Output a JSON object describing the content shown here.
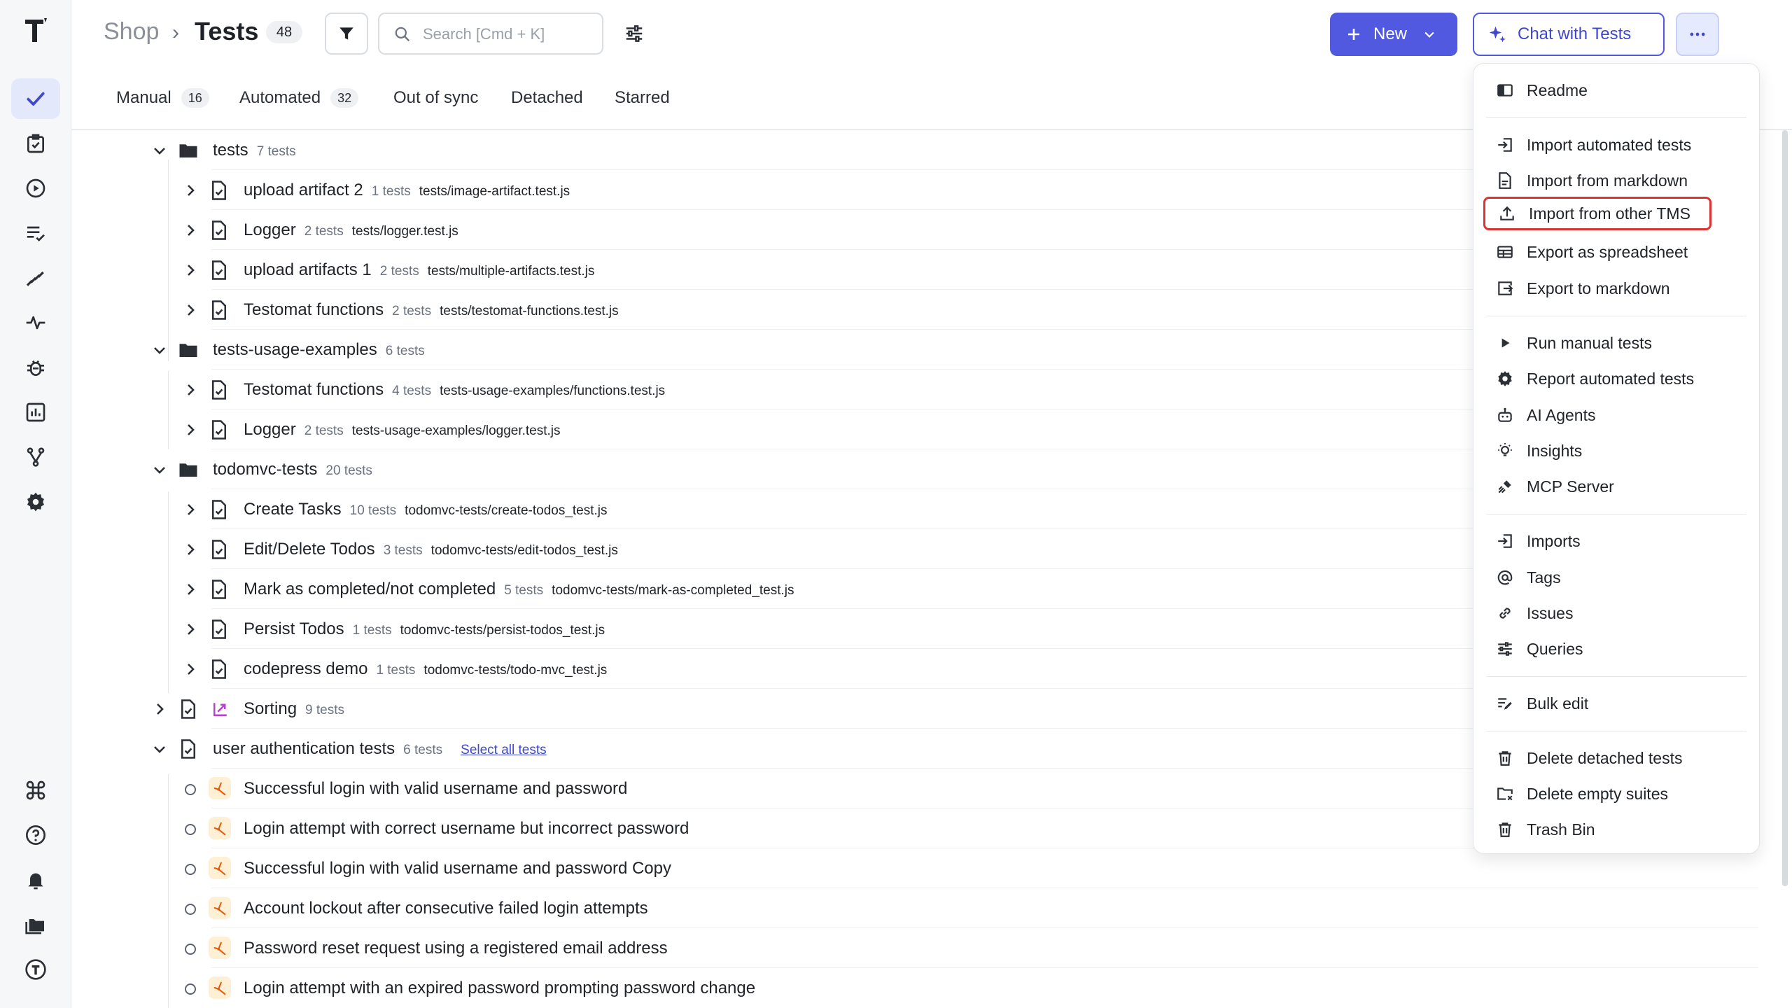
{
  "breadcrumb": {
    "root": "Shop",
    "separator": "›",
    "title": "Tests",
    "count": "48"
  },
  "search": {
    "placeholder": "Search [Cmd + K]"
  },
  "actions": {
    "new_label": "New",
    "chat_label": "Chat with Tests"
  },
  "tabs": [
    {
      "label": "Manual",
      "count": "16"
    },
    {
      "label": "Automated",
      "count": "32"
    },
    {
      "label": "Out of sync"
    },
    {
      "label": "Detached"
    },
    {
      "label": "Starred"
    }
  ],
  "tree": [
    {
      "label": "tests",
      "meta": "7 tests"
    },
    {
      "label": "upload artifact 2",
      "meta": "1 tests",
      "path": "tests/image-artifact.test.js"
    },
    {
      "label": "Logger",
      "meta": "2 tests",
      "path": "tests/logger.test.js"
    },
    {
      "label": "upload artifacts 1",
      "meta": "2 tests",
      "path": "tests/multiple-artifacts.test.js"
    },
    {
      "label": "Testomat functions",
      "meta": "2 tests",
      "path": "tests/testomat-functions.test.js"
    },
    {
      "label": "tests-usage-examples",
      "meta": "6 tests"
    },
    {
      "label": "Testomat functions",
      "meta": "4 tests",
      "path": "tests-usage-examples/functions.test.js"
    },
    {
      "label": "Logger",
      "meta": "2 tests",
      "path": "tests-usage-examples/logger.test.js"
    },
    {
      "label": "todomvc-tests",
      "meta": "20 tests"
    },
    {
      "label": "Create Tasks",
      "meta": "10 tests",
      "path": "todomvc-tests/create-todos_test.js"
    },
    {
      "label": "Edit/Delete Todos",
      "meta": "3 tests",
      "path": "todomvc-tests/edit-todos_test.js"
    },
    {
      "label": "Mark as completed/not completed",
      "meta": "5 tests",
      "path": "todomvc-tests/mark-as-completed_test.js"
    },
    {
      "label": "Persist Todos",
      "meta": "1 tests",
      "path": "todomvc-tests/persist-todos_test.js"
    },
    {
      "label": "codepress demo",
      "meta": "1 tests",
      "path": "todomvc-tests/todo-mvc_test.js"
    },
    {
      "label": "Sorting",
      "meta": "9 tests"
    },
    {
      "label": "user authentication tests",
      "meta": "6 tests",
      "link": "Select all tests"
    },
    {
      "label": "Successful login with valid username and password"
    },
    {
      "label": "Login attempt with correct username but incorrect password"
    },
    {
      "label": "Successful login with valid username and password Copy"
    },
    {
      "label": "Account lockout after consecutive failed login attempts"
    },
    {
      "label": "Password reset request using a registered email address"
    },
    {
      "label": "Login attempt with an expired password prompting password change"
    }
  ],
  "menu": [
    {
      "label": "Readme",
      "icon": "book-icon"
    },
    {
      "label": "Import automated tests",
      "icon": "import-icon"
    },
    {
      "label": "Import from markdown",
      "icon": "document-icon"
    },
    {
      "label": "Import from other TMS",
      "icon": "upload-icon"
    },
    {
      "label": "Export as spreadsheet",
      "icon": "table-icon"
    },
    {
      "label": "Export to markdown",
      "icon": "export-icon"
    },
    {
      "label": "Run manual tests",
      "icon": "play-icon"
    },
    {
      "label": "Report automated tests",
      "icon": "gear-icon"
    },
    {
      "label": "AI Agents",
      "icon": "robot-icon"
    },
    {
      "label": "Insights",
      "icon": "lightbulb-icon"
    },
    {
      "label": "MCP Server",
      "icon": "plug-icon"
    },
    {
      "label": "Imports",
      "icon": "import-icon"
    },
    {
      "label": "Tags",
      "icon": "at-icon"
    },
    {
      "label": "Issues",
      "icon": "link-icon"
    },
    {
      "label": "Queries",
      "icon": "sliders-icon"
    },
    {
      "label": "Bulk edit",
      "icon": "edit-list-icon"
    },
    {
      "label": "Delete detached tests",
      "icon": "trash-icon"
    },
    {
      "label": "Delete empty suites",
      "icon": "folder-x-icon"
    },
    {
      "label": "Trash Bin",
      "icon": "trash-icon"
    }
  ],
  "colors": {
    "accent": "#5059e0",
    "highlight": "#e03131",
    "sidebar_bg": "#f6f7f9"
  }
}
